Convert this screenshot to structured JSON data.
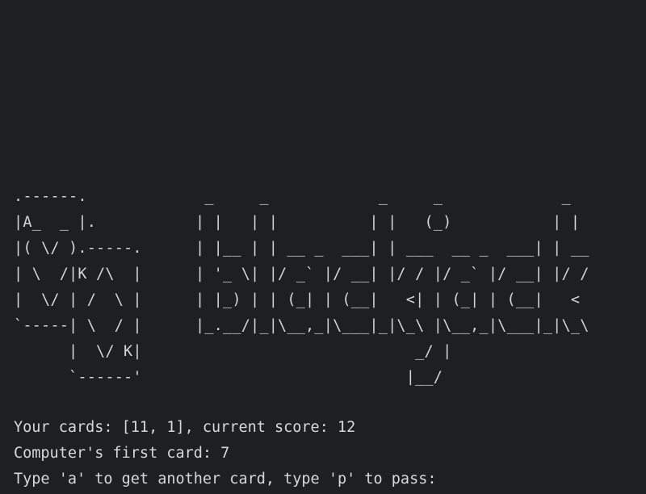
{
  "terminal": {
    "card_art": ".------.\n|A_  _ |.\n|( \\/ ).-----.\n| \\  /|K /\\  |\n|  \\/ | /  \\ |\n`-----| \\  / |\n      |  \\/ K|\n      `------'",
    "logo_art": " _     _            _     _             _\n| |   | |          | |   (_)           | |\n| |__ | | __ _  ___| | ___  __ _  ___| | __\n| '_ \\| |/ _` |/ __| |/ / |/ _` |/ __| |/ /\n| |_) | | (_| | (__|   <| | (_| | (__|   <\n|_.__/|_|\\__,_|\\___|_|\\_\\ |\\__,_|\\___|_|\\_\\\n                        _/ |\n                       |__/",
    "output_lines": [
      "Your cards: [11, 1], current score: 12",
      "Computer's first card: 7",
      "Type 'a' to get another card, type 'p' to pass:"
    ]
  },
  "colors": {
    "background": "#1e1f22",
    "text": "#d4d4d4"
  }
}
